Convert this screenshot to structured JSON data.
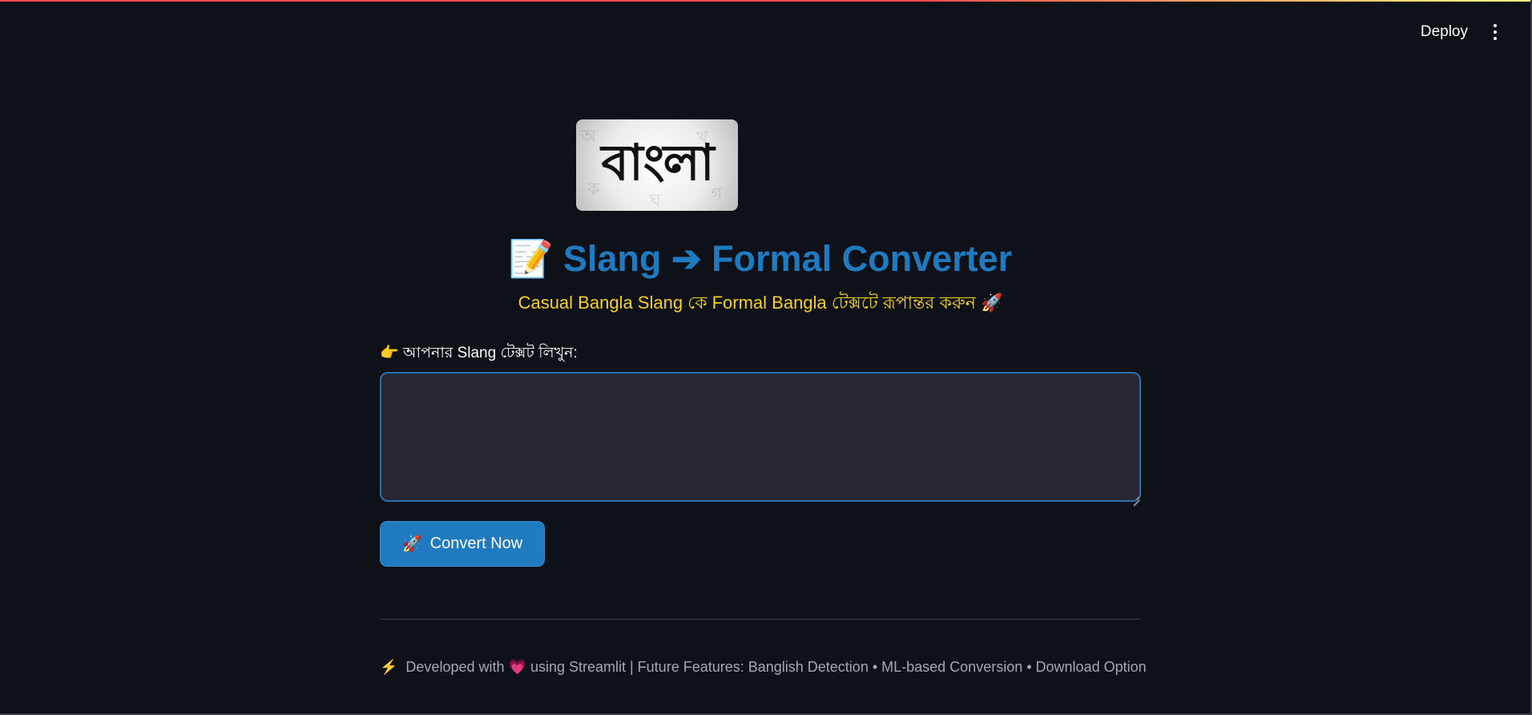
{
  "toolbar": {
    "deploy_label": "Deploy",
    "menu_icon": "kebab-menu-icon"
  },
  "logo": {
    "text": "বাংলা",
    "icon": "bangla-logo-image"
  },
  "header": {
    "title_emoji": "📝",
    "title": "Slang ➔ Formal Converter",
    "subtitle": "Casual Bangla Slang কে Formal Bangla টেক্সটে রূপান্তর করুন 🚀"
  },
  "input": {
    "label": "👉 আপনার Slang টেক্সট লিখুন:",
    "value": "",
    "placeholder": ""
  },
  "convert_button": {
    "emoji": "🚀",
    "label": "Convert Now"
  },
  "footer": {
    "bolt": "⚡",
    "text_before": "Developed with",
    "heart": "💗",
    "text_after": "using Streamlit | Future Features: Banglish Detection • ML-based Conversion • Download Option"
  },
  "colors": {
    "background": "#0e1117",
    "title": "#1f7ac0",
    "subtitle": "#f7d11c",
    "button": "#1f7ac0",
    "input_bg": "#262730",
    "input_border": "#2a71b0",
    "footer_text": "#a3a8b4"
  }
}
